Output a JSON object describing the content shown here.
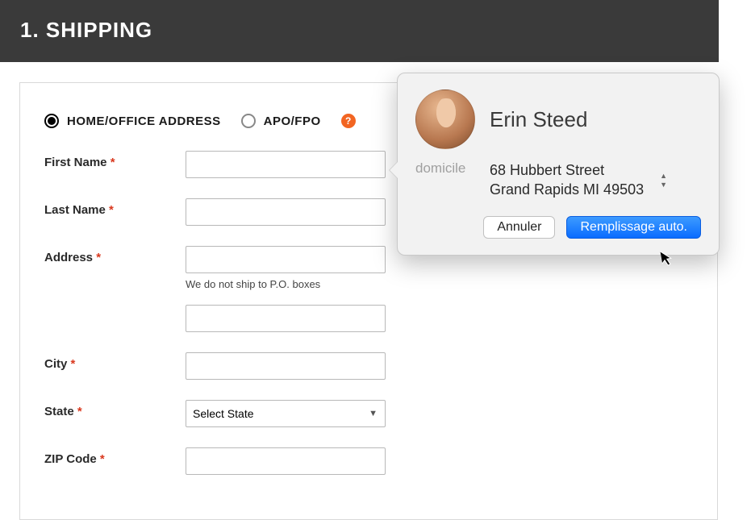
{
  "header": {
    "title": "1. SHIPPING"
  },
  "radios": {
    "home_office": "HOME/OFFICE ADDRESS",
    "apo_fpo": "APO/FPO",
    "help": "?"
  },
  "form": {
    "first_name": {
      "label": "First Name",
      "req": "*",
      "value": ""
    },
    "last_name": {
      "label": "Last Name",
      "req": "*",
      "value": ""
    },
    "address": {
      "label": "Address",
      "req": "*",
      "value": "",
      "hint": "We do not ship to P.O. boxes"
    },
    "address2": {
      "value": ""
    },
    "city": {
      "label": "City",
      "req": "*",
      "value": ""
    },
    "state": {
      "label": "State",
      "req": "*",
      "placeholder": "Select State"
    },
    "zip": {
      "label": "ZIP Code",
      "req": "*",
      "value": ""
    }
  },
  "popover": {
    "contact_name": "Erin Steed",
    "address_type": "domicile",
    "address_line1": "68 Hubbert Street",
    "address_line2": "Grand Rapids MI 49503",
    "cancel": "Annuler",
    "autofill": "Remplissage auto."
  }
}
